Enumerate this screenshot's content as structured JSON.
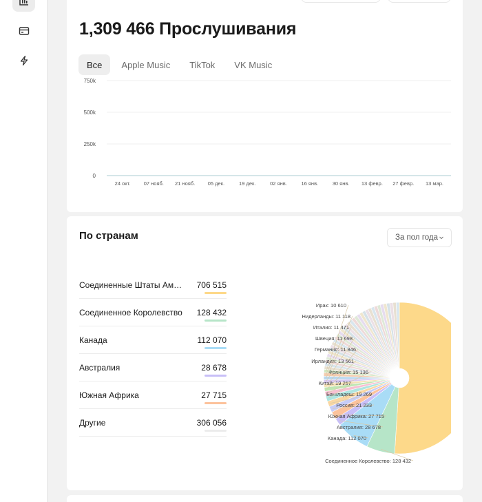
{
  "sidebar": {
    "icons": [
      "bar-chart-icon",
      "card-icon",
      "lightning-icon"
    ]
  },
  "streams": {
    "title": "1,309 466 Прослушивания",
    "tabs": [
      {
        "label": "Все",
        "active": true
      },
      {
        "label": "Apple Music",
        "active": false
      },
      {
        "label": "TikTok",
        "active": false
      },
      {
        "label": "VK Music",
        "active": false
      }
    ]
  },
  "chart_data": [
    {
      "type": "line",
      "title": "",
      "xlabel": "",
      "ylabel": "",
      "y_ticks": [
        "750k",
        "500k",
        "250k",
        "0"
      ],
      "ylim": [
        0,
        750000
      ],
      "categories": [
        "24 окт.",
        "07 нояб.",
        "21 нояб.",
        "05 дек.",
        "19 дек.",
        "02 янв.",
        "16 янв.",
        "30 янв.",
        "13 февр.",
        "27 февр.",
        "13 мар."
      ],
      "series": [
        {
          "values": [
            0,
            0,
            0,
            0,
            0,
            0,
            0,
            0,
            0,
            0,
            0
          ]
        }
      ],
      "grid": true
    },
    {
      "type": "pie",
      "donut": true,
      "labels": [
        {
          "text": "Соединенное Королевство: 128 432",
          "value": 128432
        },
        {
          "text": "Канада: 112 070",
          "value": 112070
        },
        {
          "text": "Австралия: 28 678",
          "value": 28678
        },
        {
          "text": "Южная Африка: 27 715",
          "value": 27715
        },
        {
          "text": "Россия: 21 233",
          "value": 21233
        },
        {
          "text": "Бангладеш: 19 269",
          "value": 19269
        },
        {
          "text": "Китай: 19 257",
          "value": 19257
        },
        {
          "text": "Франция: 15 136",
          "value": 15136
        },
        {
          "text": "Ирландия: 13 561",
          "value": 13561
        },
        {
          "text": "Германия: 11 846",
          "value": 11846
        },
        {
          "text": "Швеция: 11 698",
          "value": 11698
        },
        {
          "text": "Италия: 11 471",
          "value": 11471
        },
        {
          "text": "Нидерланды: 11 118",
          "value": 11118
        },
        {
          "text": "Ирак: 10 610",
          "value": 10610
        }
      ],
      "largest_slice": {
        "value": 706515,
        "color": "#fdd98a"
      },
      "slice_colors": [
        "#b6e5c8",
        "#a9dcf6",
        "#c8bff7",
        "#fcc29c",
        "#c6ccf7",
        "#f9d7a3",
        "#aee5e0",
        "#f7c0d2",
        "#bfe6b3",
        "#f4e1b5",
        "#d8c8f2",
        "#b8d8f0",
        "#f5cdb0",
        "#cfe8c2"
      ]
    }
  ],
  "countries": {
    "title": "По странам",
    "period": "За пол года",
    "rows": [
      {
        "name": "Соединенные Штаты Аме…",
        "value": "706 515",
        "color": "#fdd98a"
      },
      {
        "name": "Соединенное Королевство",
        "value": "128 432",
        "color": "#b6e5c8"
      },
      {
        "name": "Канада",
        "value": "112 070",
        "color": "#a9dcf6"
      },
      {
        "name": "Австралия",
        "value": "28 678",
        "color": "#c8bff7"
      },
      {
        "name": "Южная Африка",
        "value": "27 715",
        "color": "#fcc29c"
      },
      {
        "name": "Другие",
        "value": "306 056",
        "color": "#ececec"
      }
    ]
  }
}
